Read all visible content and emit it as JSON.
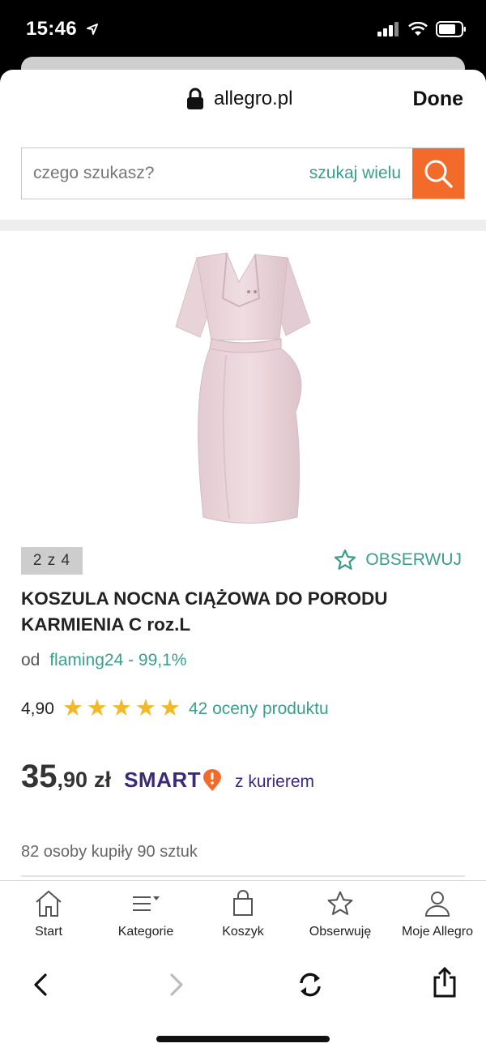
{
  "status_bar": {
    "time": "15:46"
  },
  "browser": {
    "domain": "allegro.pl",
    "done_label": "Done"
  },
  "search": {
    "placeholder": "czego szukasz?",
    "multi_label": "szukaj wielu"
  },
  "product": {
    "gallery_counter": "2 z 4",
    "observe_label": "OBSERWUJ",
    "title": "KOSZULA NOCNA CIĄŻOWA DO PORODU KARMIENIA C roz.L",
    "seller_prefix": "od",
    "seller_name": "flaming24 - 99,1%",
    "rating_value": "4,90",
    "rating_stars": 5,
    "rating_count_label": "42 oceny produktu",
    "price_int": "35",
    "price_dec": ",90",
    "price_currency": "zł",
    "smart_label": "SMART",
    "delivery_label": "z kurierem",
    "sold_label": "82 osoby kupiły 90 sztuk"
  },
  "tabbar": {
    "items": [
      {
        "label": "Start",
        "icon": "home-icon"
      },
      {
        "label": "Kategorie",
        "icon": "menu-icon"
      },
      {
        "label": "Koszyk",
        "icon": "cart-icon"
      },
      {
        "label": "Obserwuję",
        "icon": "star-outline-icon"
      },
      {
        "label": "Moje Allegro",
        "icon": "user-icon"
      }
    ]
  },
  "colors": {
    "accent_orange": "#f26b2a",
    "link_teal": "#3a9e8e",
    "star_yellow": "#f4b729",
    "smart_purple": "#3b2a78"
  }
}
